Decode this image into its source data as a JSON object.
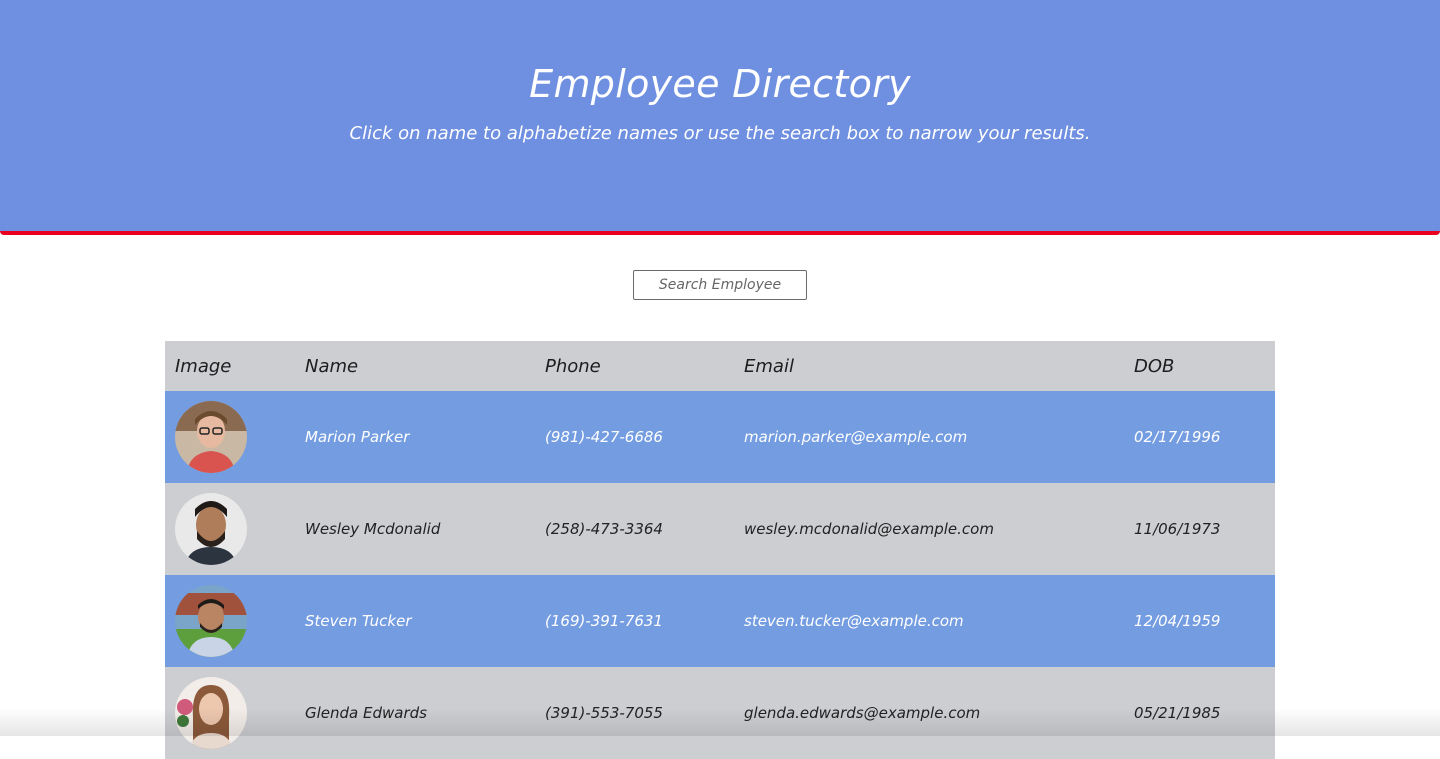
{
  "header": {
    "title": "Employee Directory",
    "subtitle": "Click on name to alphabetize names or use the search box to narrow your results."
  },
  "search": {
    "placeholder": "Search Employee",
    "value": ""
  },
  "table": {
    "columns": {
      "image": "Image",
      "name": "Name",
      "phone": "Phone",
      "email": "Email",
      "dob": "DOB"
    },
    "rows": [
      {
        "name": "Marion Parker",
        "phone": "(981)-427-6686",
        "email": "marion.parker@example.com",
        "dob": "02/17/1996"
      },
      {
        "name": "Wesley Mcdonalid",
        "phone": "(258)-473-3364",
        "email": "wesley.mcdonalid@example.com",
        "dob": "11/06/1973"
      },
      {
        "name": "Steven Tucker",
        "phone": "(169)-391-7631",
        "email": "steven.tucker@example.com",
        "dob": "12/04/1959"
      },
      {
        "name": "Glenda Edwards",
        "phone": "(391)-553-7055",
        "email": "glenda.edwards@example.com",
        "dob": "05/21/1985"
      }
    ]
  },
  "colors": {
    "header_bg": "#6f8fe0",
    "header_border": "#e8001c",
    "row_blue": "#749ce1",
    "row_grey": "#cdced2"
  }
}
